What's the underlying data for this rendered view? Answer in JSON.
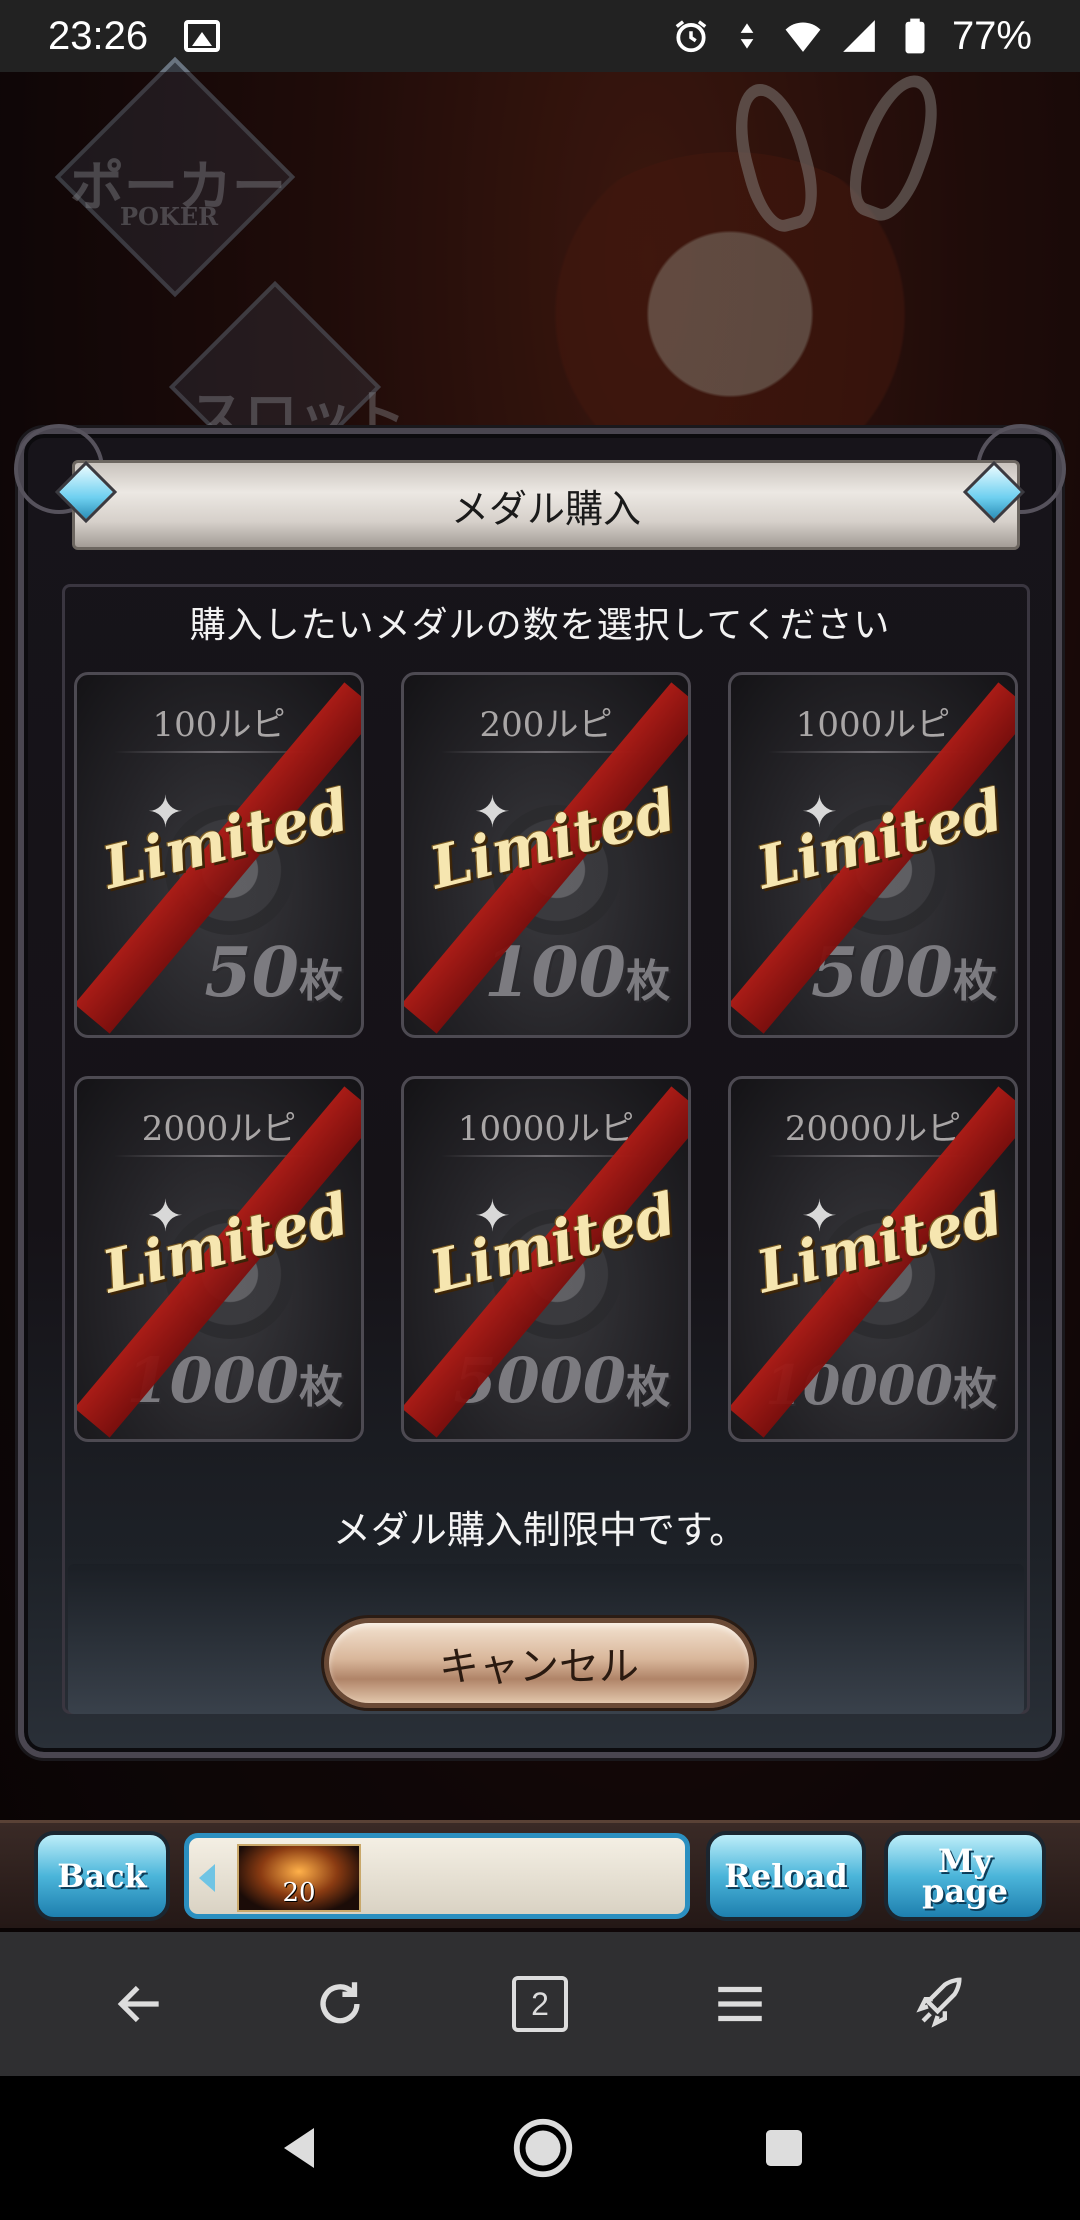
{
  "status_bar": {
    "time": "23:26",
    "battery": "77%"
  },
  "background": {
    "label_poker": "ポーカー",
    "label_poker_en": "POKER",
    "label_slot": "スロット"
  },
  "dialog": {
    "title": "メダル購入",
    "instruction": "購入したいメダルの数を選択してください",
    "items": [
      {
        "price": "100ルピ",
        "quantity": "50",
        "unit": "枚",
        "badge": "Limited"
      },
      {
        "price": "200ルピ",
        "quantity": "100",
        "unit": "枚",
        "badge": "Limited"
      },
      {
        "price": "1000ルピ",
        "quantity": "500",
        "unit": "枚",
        "badge": "Limited"
      },
      {
        "price": "2000ルピ",
        "quantity": "1000",
        "unit": "枚",
        "badge": "Limited"
      },
      {
        "price": "10000ルピ",
        "quantity": "5000",
        "unit": "枚",
        "badge": "Limited"
      },
      {
        "price": "20000ルピ",
        "quantity": "10000",
        "unit": "枚",
        "badge": "Limited"
      }
    ],
    "notice": "メダル購入制限中です。",
    "cancel_label": "キャンセル"
  },
  "game_nav": {
    "back_label": "Back",
    "reload_label": "Reload",
    "mypage_line1": "My",
    "mypage_line2": "page",
    "rank_number": "20"
  },
  "browser_bar": {
    "tab_count": "2"
  },
  "colors": {
    "limited_text": "#f6e6b0",
    "ribbon": "#b01c16",
    "accent_blue": "#4bb5da"
  }
}
